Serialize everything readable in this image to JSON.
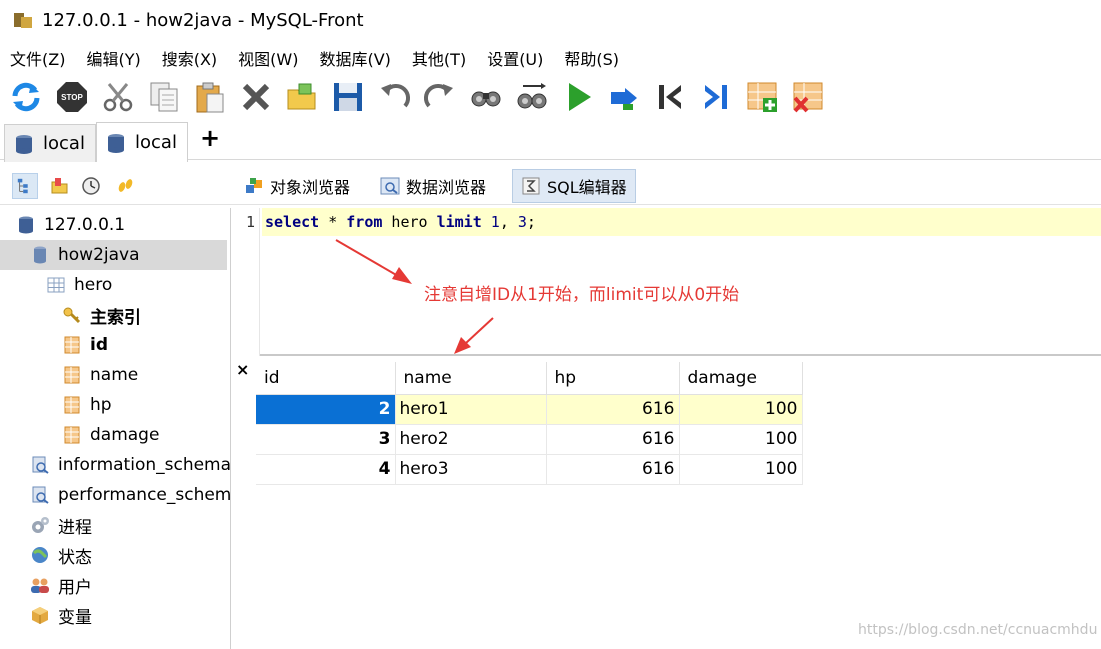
{
  "window": {
    "title": "127.0.0.1 - how2java - MySQL-Front"
  },
  "menu": [
    "文件(Z)",
    "编辑(Y)",
    "搜索(X)",
    "视图(W)",
    "数据库(V)",
    "其他(T)",
    "设置(U)",
    "帮助(S)"
  ],
  "toolbar": {
    "icons": [
      "refresh-icon",
      "stop-icon",
      "cut-icon",
      "copy-icon",
      "paste-icon",
      "delete-icon",
      "open-icon",
      "save-icon",
      "undo-icon",
      "redo-icon",
      "find-icon",
      "replace-icon",
      "run-icon",
      "run-selection-icon",
      "first-icon",
      "last-icon",
      "insert-row-icon",
      "delete-row-icon"
    ],
    "stop_label": "STOP"
  },
  "tabs": [
    {
      "label": "local",
      "active": false
    },
    {
      "label": "local",
      "active": true
    }
  ],
  "tab_add_label": "+",
  "view_buttons": [
    {
      "label": "对象浏览器",
      "active": false
    },
    {
      "label": "数据浏览器",
      "active": false
    },
    {
      "label": "SQL编辑器",
      "active": true
    }
  ],
  "tree": [
    {
      "label": "127.0.0.1",
      "icon": "server-icon"
    },
    {
      "label": "how2java",
      "icon": "database-icon"
    },
    {
      "label": "hero",
      "icon": "table-icon"
    },
    {
      "label": "主索引",
      "icon": "key-icon"
    },
    {
      "label": "id",
      "icon": "field-icon"
    },
    {
      "label": "name",
      "icon": "field-icon"
    },
    {
      "label": "hp",
      "icon": "field-icon"
    },
    {
      "label": "damage",
      "icon": "field-icon"
    },
    {
      "label": "information_schema",
      "icon": "system-db-icon"
    },
    {
      "label": "performance_schema",
      "icon": "system-db-icon"
    },
    {
      "label": "进程",
      "icon": "process-icon"
    },
    {
      "label": "状态",
      "icon": "status-icon"
    },
    {
      "label": "用户",
      "icon": "users-icon"
    },
    {
      "label": "变量",
      "icon": "variables-icon"
    }
  ],
  "editor": {
    "line_number": "1",
    "tokens": {
      "select": "select",
      "star": " * ",
      "from": "from",
      "table": " hero ",
      "limit": "limit",
      "space": " ",
      "arg1": "1",
      "comma": ", ",
      "arg2": "3",
      "end": ";"
    }
  },
  "annotation": "注意自增ID从1开始，而limit可以从0开始",
  "grid": {
    "close_label": "×",
    "columns": [
      "id",
      "name",
      "hp",
      "damage"
    ],
    "rows": [
      [
        "2",
        "hero1",
        "616",
        "100"
      ],
      [
        "3",
        "hero2",
        "616",
        "100"
      ],
      [
        "4",
        "hero3",
        "616",
        "100"
      ]
    ]
  },
  "watermark": "https://blog.csdn.net/ccnuacmhdu",
  "colors": {
    "annotation": "#e53935",
    "selection": "#0a70d4",
    "current_line": "#ffffcc"
  }
}
